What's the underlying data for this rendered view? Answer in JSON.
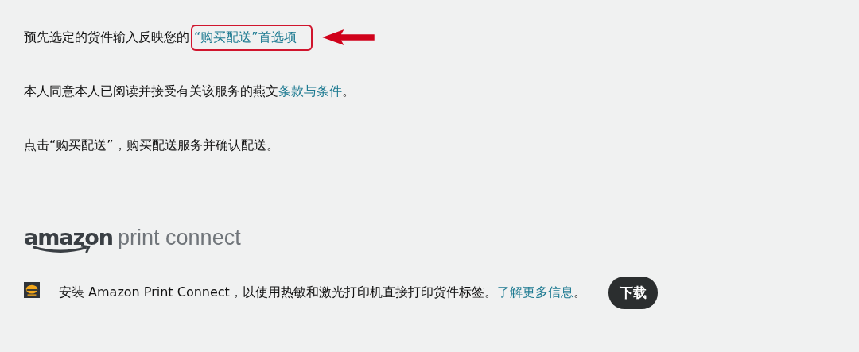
{
  "paragraphs": [
    {
      "parts": [
        {
          "kind": "text",
          "text": "预先选定的货件输入反映您的"
        },
        {
          "kind": "link",
          "text": "“购买配送”首选项",
          "highlighted": true
        }
      ]
    },
    {
      "parts": [
        {
          "kind": "text",
          "text": "本人同意本人已阅读并接受有关该服务的燕文"
        },
        {
          "kind": "link",
          "text": "条款与条件",
          "highlighted": false
        },
        {
          "kind": "text",
          "text": "。"
        }
      ]
    },
    {
      "parts": [
        {
          "kind": "text",
          "text": "点击“购买配送”，购买配送服务并确认配送。"
        }
      ]
    }
  ],
  "logo": {
    "brand": "amazon",
    "product": "print connect"
  },
  "install": {
    "parts": [
      {
        "kind": "text",
        "text": "安装 Amazon Print Connect，以使用热敏和激光打印机直接打印货件标签。"
      },
      {
        "kind": "link",
        "text": "了解更多信息",
        "highlighted": false
      },
      {
        "kind": "text",
        "text": "。"
      }
    ],
    "button": "下载"
  }
}
